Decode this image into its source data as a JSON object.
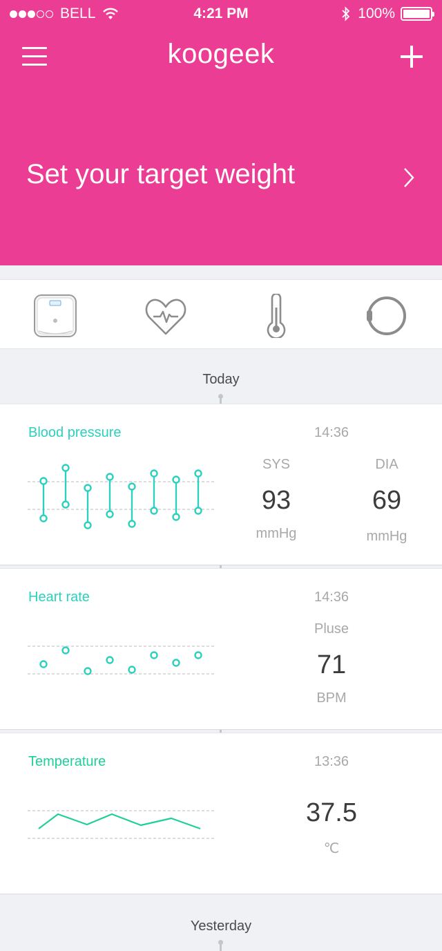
{
  "status_bar": {
    "carrier": "BELL",
    "time": "4:21 PM",
    "battery": "100%"
  },
  "header": {
    "logo": "koogeek",
    "target_prompt": "Set your target weight"
  },
  "device_tabs": [
    {
      "icon": "scale-icon",
      "active": true
    },
    {
      "icon": "heart-rate-icon",
      "active": false
    },
    {
      "icon": "thermometer-icon",
      "active": false
    },
    {
      "icon": "band-icon",
      "active": false
    }
  ],
  "sections": {
    "today_label": "Today",
    "yesterday_label": "Yesterday"
  },
  "blood_pressure": {
    "title": "Blood pressure",
    "time": "14:36",
    "sys_label": "SYS",
    "sys_value": "93",
    "sys_unit": "mmHg",
    "dia_label": "DIA",
    "dia_value": "69",
    "dia_unit": "mmHg"
  },
  "heart_rate": {
    "title": "Heart rate",
    "time": "14:36",
    "label": "Pluse",
    "value": "71",
    "unit": "BPM"
  },
  "temperature": {
    "title": "Temperature",
    "time": "13:36",
    "value": "37.5",
    "unit": "℃"
  },
  "colors": {
    "brand": "#ec3d95",
    "teal": "#2bd0bf",
    "green": "#1fcf9a"
  }
}
